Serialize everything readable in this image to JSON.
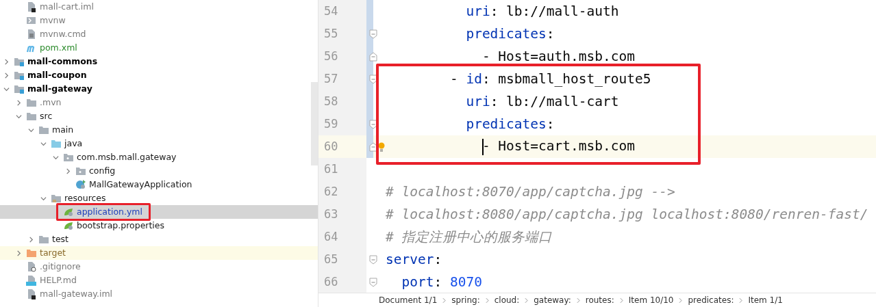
{
  "project_tree": [
    {
      "children": [
        {
          "label": "mall-cart.iml",
          "kind": "iml",
          "color": "#7a7a7a",
          "selected": false
        },
        {
          "label": "mvnw",
          "kind": "script",
          "color": "#7a7a7a",
          "selected": false
        },
        {
          "label": "mvnw.cmd",
          "kind": "text-file",
          "color": "#7a7a7a",
          "selected": false
        },
        {
          "label": "pom.xml",
          "kind": "maven",
          "color": "#2a8a2a",
          "selected": false
        }
      ]
    },
    {
      "label": "mall-commons",
      "kind": "module",
      "color": "#000000",
      "expanded": false,
      "selected": false
    },
    {
      "label": "mall-coupon",
      "kind": "module",
      "color": "#000000",
      "expanded": false,
      "selected": false
    },
    {
      "label": "mall-gateway",
      "kind": "module",
      "color": "#000000",
      "expanded": true,
      "selected": false,
      "children": [
        {
          "label": ".mvn",
          "kind": "folder",
          "color": "#7a7a7a",
          "expanded": false,
          "selected": false
        },
        {
          "label": "src",
          "kind": "folder",
          "color": "#1a1a1a",
          "expanded": true,
          "selected": false,
          "children": [
            {
              "label": "main",
              "kind": "folder",
              "color": "#1a1a1a",
              "expanded": true,
              "selected": false,
              "children": [
                {
                  "label": "java",
                  "kind": "source-folder",
                  "color": "#1a1a1a",
                  "expanded": true,
                  "selected": false,
                  "children": [
                    {
                      "label": "com.msb.mall.gateway",
                      "kind": "package",
                      "color": "#1a1a1a",
                      "expanded": true,
                      "selected": false,
                      "children": [
                        {
                          "label": "config",
                          "kind": "package",
                          "color": "#1a1a1a",
                          "expanded": false,
                          "selected": false
                        },
                        {
                          "label": "MallGatewayApplication",
                          "kind": "spring-class",
                          "color": "#1a1a1a",
                          "selected": false
                        }
                      ]
                    }
                  ]
                },
                {
                  "label": "resources",
                  "kind": "resources-folder",
                  "color": "#1a1a1a",
                  "expanded": true,
                  "selected": false,
                  "children": [
                    {
                      "label": "application.yml",
                      "kind": "spring-config",
                      "color": "#1d3fbb",
                      "selected": true,
                      "highlighted": true
                    },
                    {
                      "label": "bootstrap.properties",
                      "kind": "spring-config",
                      "color": "#1a1a1a",
                      "selected": false
                    }
                  ]
                }
              ]
            },
            {
              "label": "test",
              "kind": "folder",
              "color": "#1a1a1a",
              "expanded": false,
              "selected": false
            }
          ]
        },
        {
          "label": "target",
          "kind": "excluded-folder",
          "color": "#8a6a2a",
          "expanded": false,
          "selected": false
        },
        {
          "label": ".gitignore",
          "kind": "gitignore",
          "color": "#7a7a7a",
          "selected": false
        },
        {
          "label": "HELP.md",
          "kind": "markdown",
          "color": "#7a7a7a",
          "selected": false
        },
        {
          "label": "mall-gateway.iml",
          "kind": "iml",
          "color": "#7a7a7a",
          "selected": false
        }
      ]
    }
  ],
  "editor": {
    "lines": [
      {
        "number": "54",
        "kind": "plain",
        "changed": true,
        "current": false,
        "tokens": [
          {
            "kind": "key",
            "text": "          uri"
          },
          {
            "kind": "plain",
            "text": ": lb://mall-auth"
          }
        ]
      },
      {
        "number": "55",
        "kind": "fold-start",
        "changed": true,
        "current": false,
        "tokens": [
          {
            "kind": "key",
            "text": "          predicates"
          },
          {
            "kind": "plain",
            "text": ":"
          }
        ]
      },
      {
        "number": "56",
        "kind": "fold-end",
        "changed": true,
        "current": false,
        "tokens": [
          {
            "kind": "plain",
            "text": "            - Host=auth.msb.com"
          }
        ]
      },
      {
        "number": "57",
        "kind": "fold-start",
        "changed": true,
        "current": false,
        "highlighted": true,
        "tokens": [
          {
            "kind": "plain",
            "text": "        - "
          },
          {
            "kind": "key",
            "text": "id"
          },
          {
            "kind": "plain",
            "text": ": msbmall_host_route5"
          }
        ]
      },
      {
        "number": "58",
        "kind": "plain",
        "changed": true,
        "current": false,
        "highlighted": true,
        "tokens": [
          {
            "kind": "key",
            "text": "          uri"
          },
          {
            "kind": "plain",
            "text": ": lb://mall-cart"
          }
        ]
      },
      {
        "number": "59",
        "kind": "fold-start",
        "changed": true,
        "current": false,
        "highlighted": true,
        "tokens": [
          {
            "kind": "key",
            "text": "          predicates"
          },
          {
            "kind": "plain",
            "text": ":"
          }
        ]
      },
      {
        "number": "60",
        "kind": "fold-end",
        "changed": true,
        "current": true,
        "highlighted": true,
        "bulb": true,
        "caret": true,
        "tokens": [
          {
            "kind": "plain",
            "text": "            - Host=cart.msb.com"
          }
        ]
      },
      {
        "number": "61",
        "kind": "plain",
        "changed": false,
        "current": false
      },
      {
        "number": "62",
        "kind": "plain",
        "changed": false,
        "current": false,
        "tokens": [
          {
            "kind": "comment",
            "text": "# localhost:8070/app/captcha.jpg -->"
          }
        ]
      },
      {
        "number": "63",
        "kind": "plain",
        "changed": false,
        "current": false,
        "tokens": [
          {
            "kind": "comment",
            "text": "# localhost:8080/app/captcha.jpg localhost:8080/renren-fast/"
          }
        ]
      },
      {
        "number": "64",
        "kind": "plain",
        "changed": false,
        "current": false,
        "tokens": [
          {
            "kind": "comment",
            "text": "# 指定注册中心的服务端口"
          }
        ]
      },
      {
        "number": "65",
        "kind": "fold-start",
        "changed": false,
        "current": false,
        "tokens": [
          {
            "kind": "key",
            "text": "server"
          },
          {
            "kind": "plain",
            "text": ":"
          }
        ]
      },
      {
        "number": "66",
        "kind": "fold-start",
        "changed": false,
        "current": false,
        "tokens": [
          {
            "kind": "key",
            "text": "  port"
          },
          {
            "kind": "plain",
            "text": ": "
          },
          {
            "kind": "number",
            "text": "8070"
          }
        ]
      }
    ]
  },
  "breadcrumbs": [
    "Document 1/1",
    "spring:",
    "cloud:",
    "gateway:",
    "routes:",
    "Item 10/10",
    "predicates:",
    "Item 1/1"
  ]
}
